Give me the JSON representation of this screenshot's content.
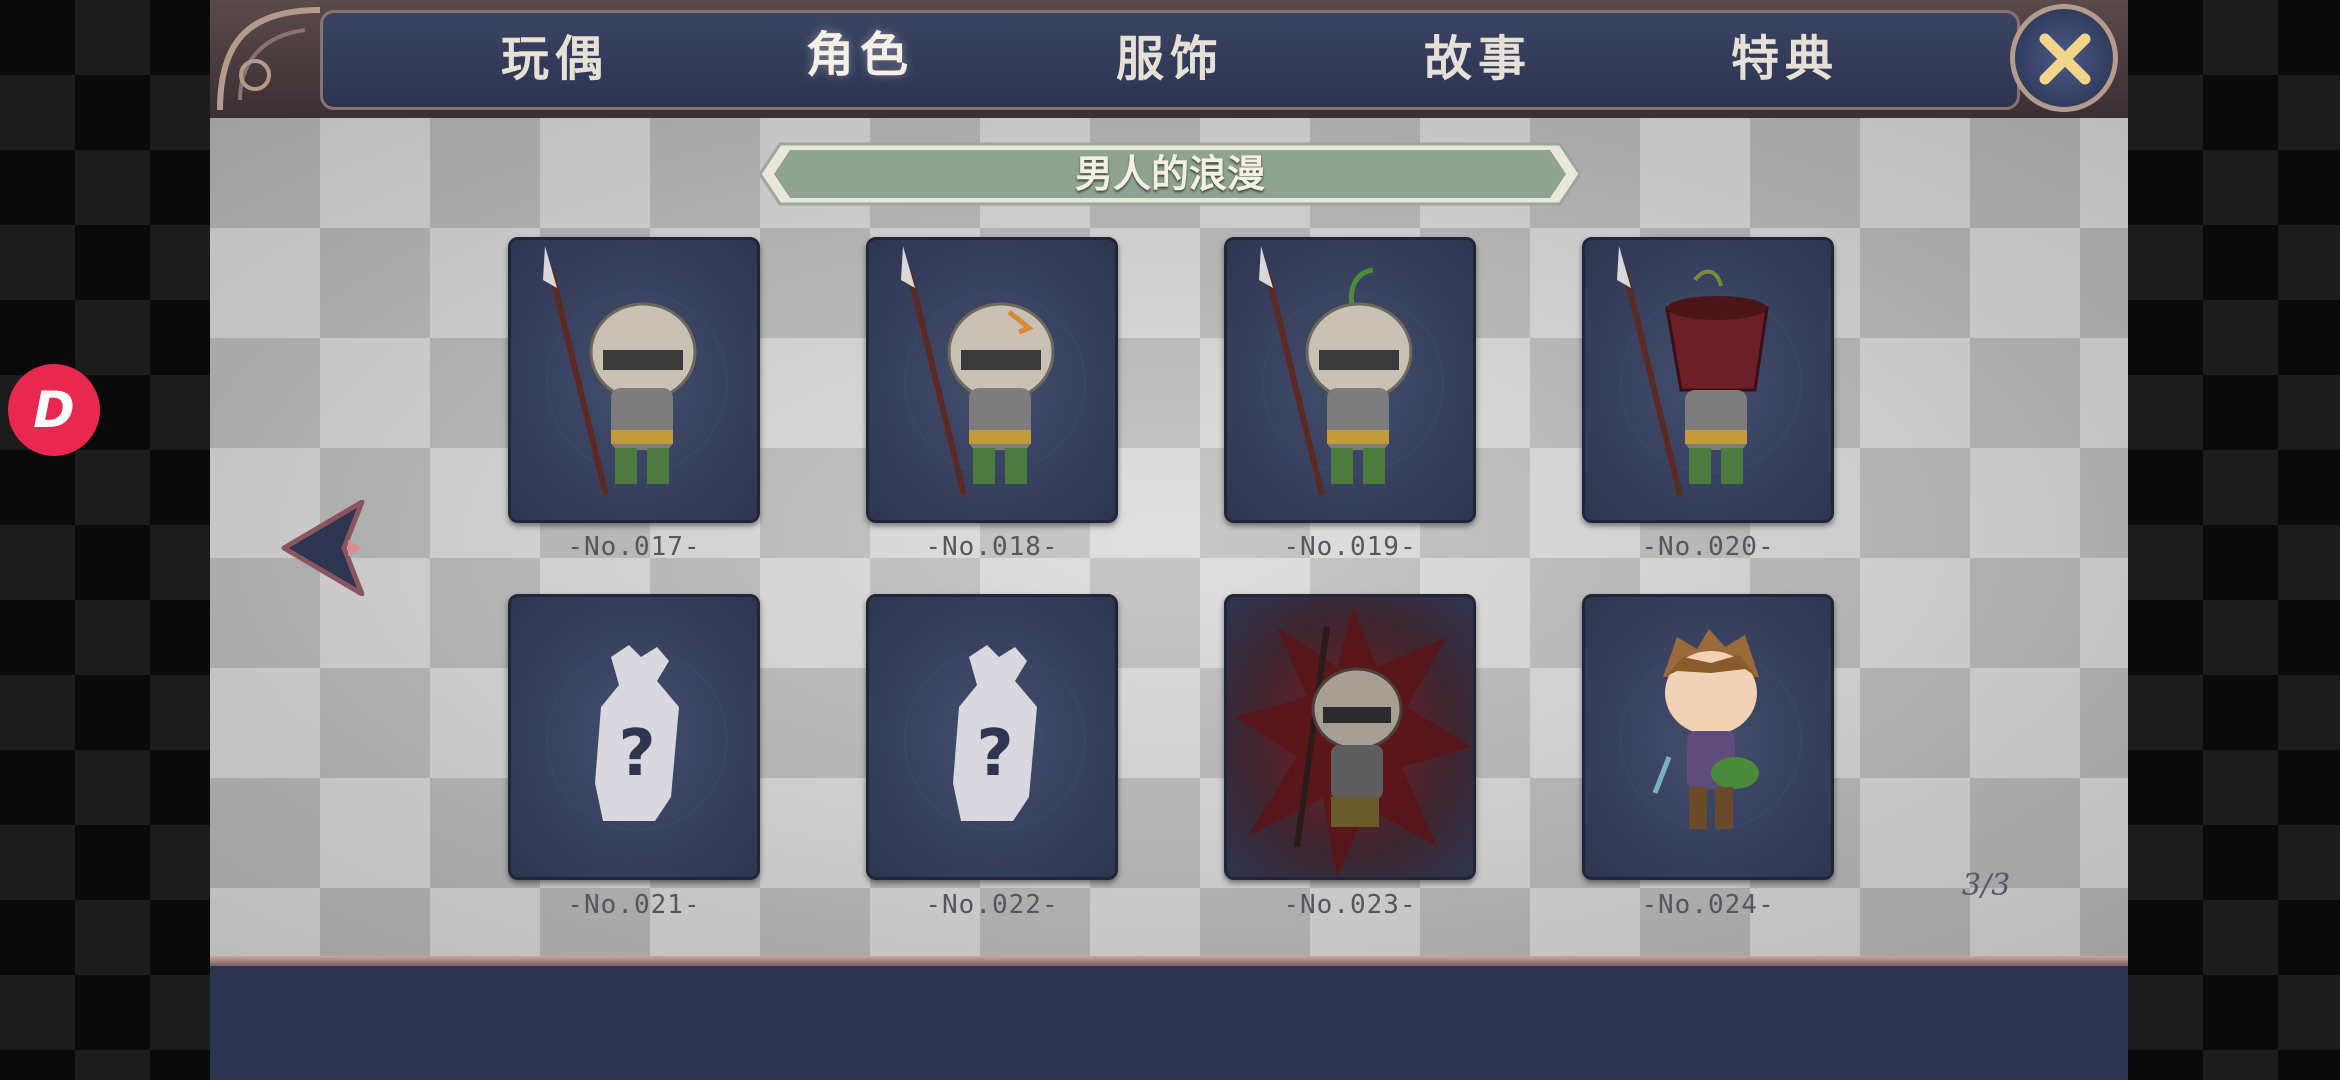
{
  "tabs": [
    {
      "label": "玩偶",
      "active": false
    },
    {
      "label": "角色",
      "active": true
    },
    {
      "label": "服饰",
      "active": false
    },
    {
      "label": "故事",
      "active": false
    },
    {
      "label": "特典",
      "active": false
    }
  ],
  "banner_title": "男人的浪漫",
  "cards": [
    {
      "number": "-No.017-",
      "state": "unlocked",
      "icon": "soldier-helmet-spear"
    },
    {
      "number": "-No.018-",
      "state": "unlocked",
      "icon": "soldier-helmet-patched"
    },
    {
      "number": "-No.019-",
      "state": "unlocked",
      "icon": "soldier-helmet-sprout"
    },
    {
      "number": "-No.020-",
      "state": "unlocked",
      "icon": "soldier-pot-helmet"
    },
    {
      "number": "-No.021-",
      "state": "locked",
      "icon": "mystery-silhouette"
    },
    {
      "number": "-No.022-",
      "state": "locked",
      "icon": "mystery-silhouette"
    },
    {
      "number": "-No.023-",
      "state": "unlocked",
      "icon": "soldier-red-aura"
    },
    {
      "number": "-No.024-",
      "state": "unlocked",
      "icon": "boy-green-bag"
    }
  ],
  "page_indicator": "3/3",
  "colors": {
    "panel": "#2d3550",
    "banner": "#8fa392",
    "tab_text": "#e6e0d6",
    "overlay_logo": "#e8284f"
  }
}
